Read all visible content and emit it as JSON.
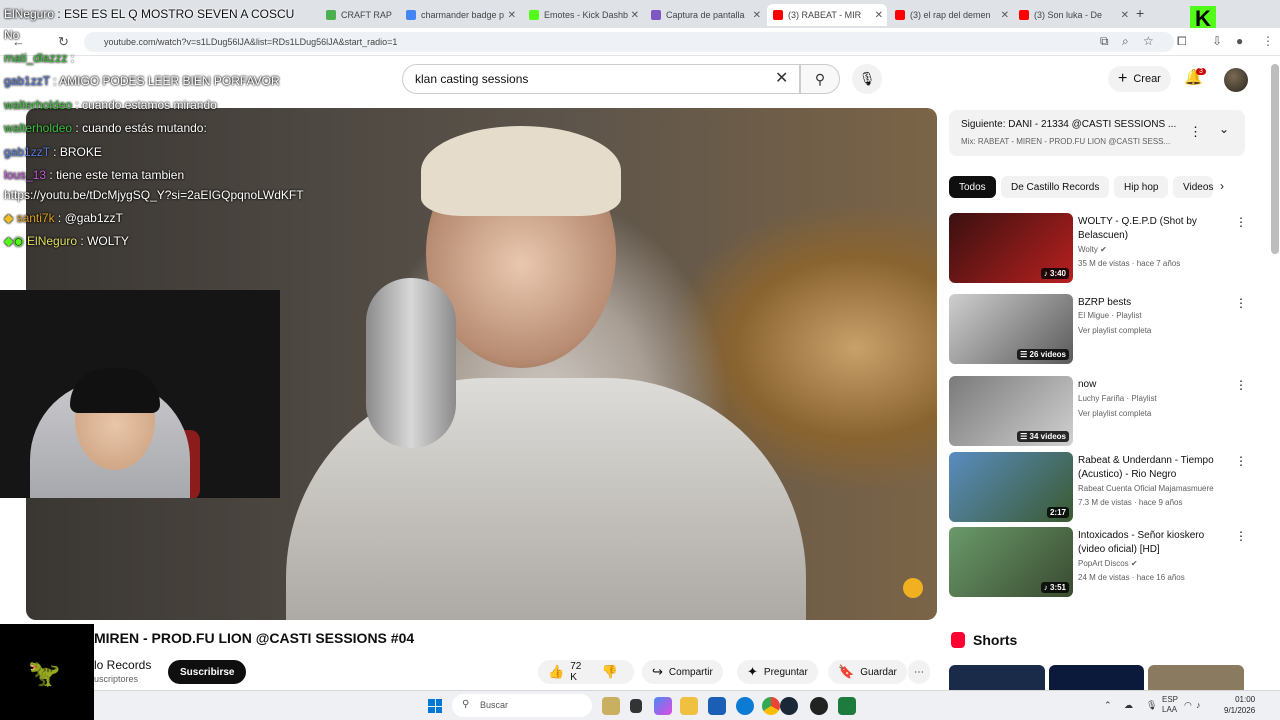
{
  "browser": {
    "tabs": [
      {
        "label": "CRAFT RAP",
        "favicon_color": "#4caf50"
      },
      {
        "label": "charmander badge p",
        "favicon_color": "#4285f4"
      },
      {
        "label": "Emotes - Kick Dashb",
        "favicon_color": "#53fc18"
      },
      {
        "label": "Captura de pantalla",
        "favicon_color": "#7e57c2"
      },
      {
        "label": "(3) RABEAT - MIR",
        "favicon_color": "#ff0000"
      },
      {
        "label": "(3) el rap del demen",
        "favicon_color": "#ff0000"
      },
      {
        "label": "(3) Son luka - De",
        "favicon_color": "#ff0000"
      }
    ],
    "new_tab": "+",
    "url": "youtube.com/watch?v=s1LDug56lJA&list=RDs1LDug56lJA&start_radio=1",
    "kick_logo": "K"
  },
  "youtube": {
    "search_value": "klan casting sessions",
    "create_label": "Crear",
    "notification_count": "3"
  },
  "chat": [
    {
      "user": "ElNeguro",
      "sep": " : ",
      "msg": "ESE ES EL Q MOSTRO SEVEN A COSCU",
      "user_color": "#ffffff",
      "dark": true
    },
    {
      "user": "No",
      "sep": "",
      "msg": "",
      "user_color": "#ffffff",
      "dark": true
    },
    {
      "user": "mati_dlazzz",
      "sep": " : ",
      "msg": "",
      "user_color": "#3fbf3f",
      "dark": false
    },
    {
      "user": "gab1zzT",
      "sep": " : ",
      "msg": "AMIGO PODES LEER BIEN PORFAVOR",
      "user_color": "#5a7bd6",
      "dark": false
    },
    {
      "user": "walterholdeo",
      "sep": " : ",
      "msg": "cuando estamos mirando",
      "user_color": "#3fbf3f",
      "dark": false
    },
    {
      "user": "walterholdeo",
      "sep": " : ",
      "msg": "cuando estás mutando:",
      "user_color": "#3fbf3f",
      "dark": false
    },
    {
      "user": "gab1zzT",
      "sep": " : ",
      "msg": "BROKE",
      "user_color": "#5a7bd6",
      "dark": false
    },
    {
      "user": "lous_13",
      "sep": " : ",
      "msg": "tiene este tema tambien",
      "user_color": "#c25ad6",
      "dark": false
    },
    {
      "user": "",
      "sep": "",
      "msg": "https://youtu.be/tDcMjygSQ_Y?si=2aEIGQpqnoLWdKFT",
      "user_color": "#ffffff",
      "dark": false
    },
    {
      "user": "santi7k",
      "sep": " : ",
      "msg": "@gab1zzT",
      "user_color": "#e0a020",
      "dark": false
    },
    {
      "user": "ElNeguro",
      "sep": " : ",
      "msg": "WOLTY",
      "user_color": "#e0e060",
      "dark": false
    }
  ],
  "video": {
    "title": "MIREN - PROD.FU LION @CASTI SESSIONS #04",
    "channel": "lo Records",
    "subs": "uscriptores",
    "subscribe_label": "Suscribirse",
    "likes": "72 K",
    "share_label": "Compartir",
    "ask_label": "Preguntar",
    "save_label": "Guardar"
  },
  "sidebar": {
    "next_title": "Siguiente: DANI - 21334 @CASTI SESSIONS ...",
    "next_sub": "Mix: RABEAT - MIREN - PROD.FU LION @CASTI SESS...",
    "chips": [
      "Todos",
      "De Castillo Records",
      "Hip hop",
      "Videos"
    ],
    "recommendations": [
      {
        "title": "WOLTY - Q.E.P.D (Shot by Belascuen)",
        "meta1": "Wolty ✔",
        "meta2": "35 M de vistas · hace 7 años",
        "duration": "♪ 3:40",
        "colors": [
          "#3a1010",
          "#b82020"
        ]
      },
      {
        "title": "BZRP bests",
        "meta1": "El Migue · Playlist",
        "meta2": "Ver playlist completa",
        "duration": "☰ 26 videos",
        "colors": [
          "#cfcfcf",
          "#5a5a5a"
        ]
      },
      {
        "title": "now",
        "meta1": "Luchy Fariña · Playlist",
        "meta2": "Ver playlist completa",
        "duration": "☰ 34 videos",
        "colors": [
          "#7a7a7a",
          "#d0d0d0"
        ]
      },
      {
        "title": "Rabeat &  Underdann - Tiempo (Acustico) - Rio Negro",
        "meta1": "Rabeat Cuenta Oficial Majamasmuere",
        "meta2": "7.3 M de vistas · hace 9 años",
        "duration": "2:17",
        "colors": [
          "#5a8cc0",
          "#3a5a30"
        ]
      },
      {
        "title": "Intoxicados - Señor kioskero (video oficial) [HD]",
        "meta1": "PopArt Discos ✔",
        "meta2": "24 M de vistas · hace 16 años",
        "duration": "♪ 3:51",
        "colors": [
          "#6a9a6a",
          "#3a4a30"
        ]
      }
    ],
    "shorts_label": "Shorts"
  },
  "taskbar": {
    "search_label": "Buscar",
    "lang": "ESP",
    "lang2": "LAA",
    "time": "01:00",
    "date": "9/1/2026"
  }
}
